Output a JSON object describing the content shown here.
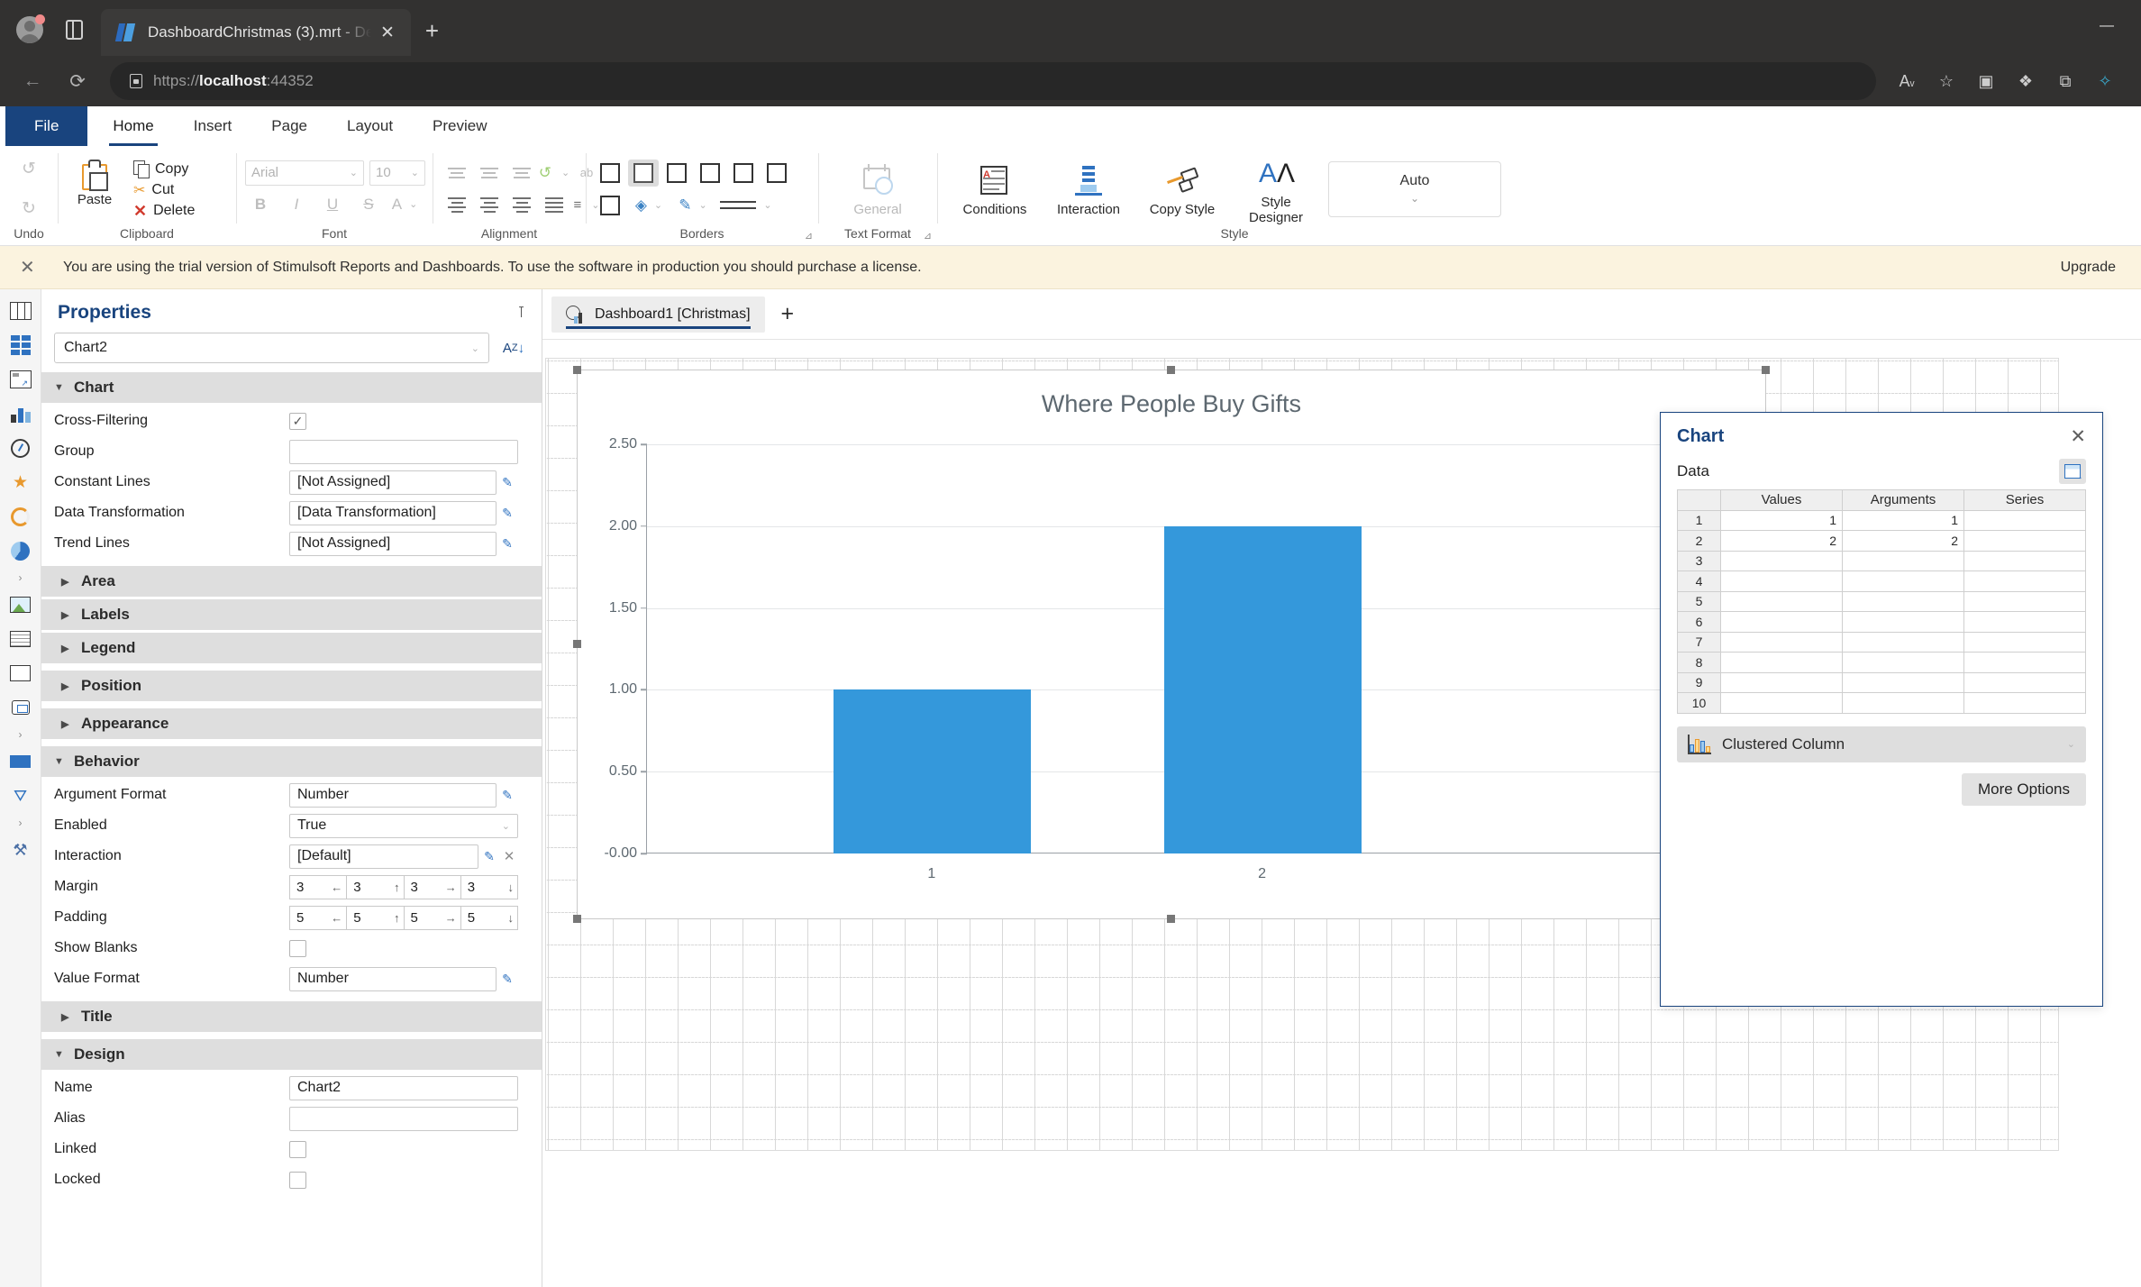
{
  "browser": {
    "tab_title": "DashboardChristmas (3).mrt - De",
    "tab_close": "✕",
    "new_tab": "+",
    "back_icon": "←",
    "reload_icon": "⟳",
    "url_scheme": "https://",
    "url_host": "localhost",
    "url_port": ":44352",
    "minimize": "—",
    "address_actions": [
      "read-aloud-icon",
      "favorite-icon",
      "split-screen-icon",
      "collections-icon",
      "browser-essentials-icon",
      "extensions-icon"
    ]
  },
  "ribbon": {
    "tabs": [
      {
        "label": "File",
        "type": "file"
      },
      {
        "label": "Home",
        "type": "active"
      },
      {
        "label": "Insert",
        "type": "normal"
      },
      {
        "label": "Page",
        "type": "normal"
      },
      {
        "label": "Layout",
        "type": "normal"
      },
      {
        "label": "Preview",
        "type": "normal"
      }
    ],
    "groups": {
      "undo": {
        "label": "Undo",
        "undo_icon": "↺",
        "redo_icon": "↻"
      },
      "clipboard": {
        "label": "Clipboard",
        "paste": "Paste",
        "copy": "Copy",
        "cut": "Cut",
        "delete": "Delete"
      },
      "font": {
        "label": "Font",
        "family": "Arial",
        "size": "10",
        "bold": "B",
        "italic": "I",
        "underline": "U",
        "strike": "S",
        "font_color": "A"
      },
      "alignment": {
        "label": "Alignment",
        "wrap_text": "ab"
      },
      "borders": {
        "label": "Borders"
      },
      "text_format": {
        "label": "Text Format",
        "value": "General"
      },
      "style": {
        "label": "Style",
        "conditions": "Conditions",
        "interaction": "Interaction",
        "copy_style": "Copy Style",
        "style_designer": "Style Designer",
        "auto": "Auto"
      }
    }
  },
  "trial_banner": {
    "close": "✕",
    "message": "You are using the trial version of Stimulsoft Reports and Dashboards. To use the software in production you should purchase a license.",
    "upgrade": "Upgrade"
  },
  "properties": {
    "title": "Properties",
    "pin_icon": "pin-icon",
    "selected_object": "Chart2",
    "sort_icon": "sort-az-icon",
    "sections": [
      {
        "name": "Chart",
        "expanded": true,
        "rows": [
          {
            "label": "Cross-Filtering",
            "type": "checkbox",
            "checked": true
          },
          {
            "label": "Group",
            "type": "text",
            "value": ""
          },
          {
            "label": "Constant Lines",
            "type": "text-edit",
            "value": "[Not Assigned]"
          },
          {
            "label": "Data Transformation",
            "type": "text-edit",
            "value": "[Data Transformation]"
          },
          {
            "label": "Trend Lines",
            "type": "text-edit",
            "value": "[Not Assigned]"
          }
        ]
      },
      {
        "name": "Area",
        "expanded": false,
        "nested": true,
        "rows": []
      },
      {
        "name": "Labels",
        "expanded": false,
        "nested": true,
        "rows": []
      },
      {
        "name": "Legend",
        "expanded": false,
        "nested": true,
        "rows": []
      },
      {
        "name": "Position",
        "expanded": false,
        "nested": true,
        "rows": []
      },
      {
        "name": "Appearance",
        "expanded": false,
        "nested": true,
        "rows": []
      },
      {
        "name": "Behavior",
        "expanded": true,
        "rows": [
          {
            "label": "Argument Format",
            "type": "text-edit",
            "value": "Number"
          },
          {
            "label": "Enabled",
            "type": "select",
            "value": "True"
          },
          {
            "label": "Interaction",
            "type": "text-edit-clear",
            "value": "[Default]"
          },
          {
            "label": "Margin",
            "type": "quad",
            "values": [
              "3",
              "3",
              "3",
              "3"
            ]
          },
          {
            "label": "Padding",
            "type": "quad",
            "values": [
              "5",
              "5",
              "5",
              "5"
            ]
          },
          {
            "label": "Show Blanks",
            "type": "checkbox",
            "checked": false
          },
          {
            "label": "Value Format",
            "type": "text-edit",
            "value": "Number"
          }
        ]
      },
      {
        "name": "Title",
        "expanded": false,
        "nested": true,
        "rows": []
      },
      {
        "name": "Design",
        "expanded": true,
        "rows": [
          {
            "label": "Name",
            "type": "text",
            "value": "Chart2"
          },
          {
            "label": "Alias",
            "type": "text",
            "value": ""
          },
          {
            "label": "Linked",
            "type": "checkbox",
            "checked": false
          },
          {
            "label": "Locked",
            "type": "checkbox",
            "checked": false
          }
        ]
      }
    ]
  },
  "designer": {
    "tab_label": "Dashboard1 [Christmas]",
    "add_tab": "+"
  },
  "chart_dialog": {
    "title": "Chart",
    "close": "✕",
    "data_label": "Data",
    "grid_icon": "insert-data-icon",
    "columns": [
      "",
      "Values",
      "Arguments",
      "Series"
    ],
    "rows": [
      {
        "n": "1",
        "values": "1",
        "arguments": "1",
        "series": ""
      },
      {
        "n": "2",
        "values": "2",
        "arguments": "2",
        "series": ""
      },
      {
        "n": "3",
        "values": "",
        "arguments": "",
        "series": ""
      },
      {
        "n": "4",
        "values": "",
        "arguments": "",
        "series": ""
      },
      {
        "n": "5",
        "values": "",
        "arguments": "",
        "series": ""
      },
      {
        "n": "6",
        "values": "",
        "arguments": "",
        "series": ""
      },
      {
        "n": "7",
        "values": "",
        "arguments": "",
        "series": ""
      },
      {
        "n": "8",
        "values": "",
        "arguments": "",
        "series": ""
      },
      {
        "n": "9",
        "values": "",
        "arguments": "",
        "series": ""
      },
      {
        "n": "10",
        "values": "",
        "arguments": "",
        "series": ""
      }
    ],
    "chart_type": "Clustered Column",
    "more_options": "More Options"
  },
  "chart_data": {
    "type": "bar",
    "title": "Where People Buy Gifts",
    "categories": [
      "1",
      "2"
    ],
    "values": [
      1,
      2
    ],
    "xlabel": "",
    "ylabel": "",
    "ylim": [
      0,
      2.5
    ],
    "yticks": [
      "2.50",
      "2.00",
      "1.50",
      "1.00",
      "0.50",
      "-0.00"
    ],
    "ytick_values": [
      2.5,
      2.0,
      1.5,
      1.0,
      0.5,
      0
    ],
    "grid": true,
    "legend": "none",
    "bar_color": "#3498db"
  }
}
